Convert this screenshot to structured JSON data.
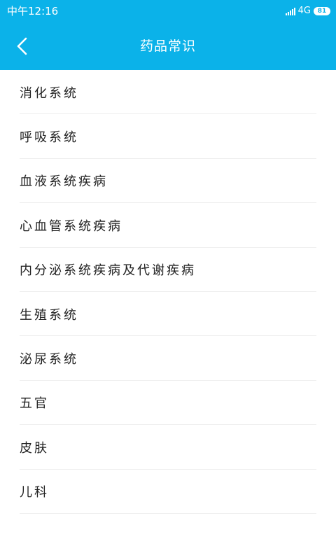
{
  "status_bar": {
    "time": "中午12:16",
    "network": "4G",
    "battery": "81"
  },
  "header": {
    "title": "药品常识",
    "back_icon": "chevron-left-icon"
  },
  "colors": {
    "header_bg": "#0bb2e9",
    "text": "#222222",
    "divider": "#efefef"
  },
  "categories": [
    {
      "label": "消化系统"
    },
    {
      "label": "呼吸系统"
    },
    {
      "label": "血液系统疾病"
    },
    {
      "label": "心血管系统疾病"
    },
    {
      "label": "内分泌系统疾病及代谢疾病"
    },
    {
      "label": "生殖系统"
    },
    {
      "label": "泌尿系统"
    },
    {
      "label": "五官"
    },
    {
      "label": "皮肤"
    },
    {
      "label": "儿科"
    }
  ]
}
